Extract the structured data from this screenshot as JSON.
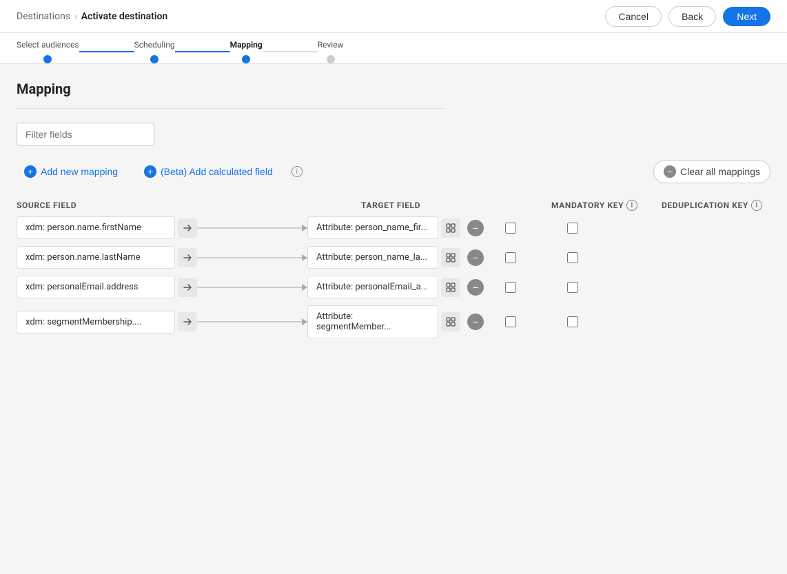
{
  "header": {
    "breadcrumb_parent": "Destinations",
    "breadcrumb_separator": "›",
    "breadcrumb_current": "Activate destination",
    "cancel_label": "Cancel",
    "back_label": "Back",
    "next_label": "Next"
  },
  "stepper": {
    "steps": [
      {
        "label": "Select audiences",
        "state": "completed"
      },
      {
        "label": "Scheduling",
        "state": "completed"
      },
      {
        "label": "Mapping",
        "state": "active"
      },
      {
        "label": "Review",
        "state": "inactive"
      }
    ]
  },
  "mapping": {
    "title": "Mapping",
    "filter_placeholder": "Filter fields",
    "add_mapping_label": "Add new mapping",
    "add_calculated_label": "(Beta) Add calculated field",
    "clear_all_label": "Clear all mappings",
    "columns": {
      "source": "SOURCE FIELD",
      "target": "TARGET FIELD",
      "mandatory": "MANDATORY KEY",
      "dedup": "DEDUPLICATION KEY"
    },
    "rows": [
      {
        "source": "xdm: person.name.firstName",
        "target": "Attribute: person_name_fir...",
        "mandatory_checked": false,
        "dedup_checked": false
      },
      {
        "source": "xdm: person.name.lastName",
        "target": "Attribute: person_name_la...",
        "mandatory_checked": false,
        "dedup_checked": false
      },
      {
        "source": "xdm: personalEmail.address",
        "target": "Attribute: personalEmail_a...",
        "mandatory_checked": false,
        "dedup_checked": false
      },
      {
        "source": "xdm: segmentMembership....",
        "target": "Attribute: segmentMember...",
        "mandatory_checked": false,
        "dedup_checked": false
      }
    ]
  }
}
